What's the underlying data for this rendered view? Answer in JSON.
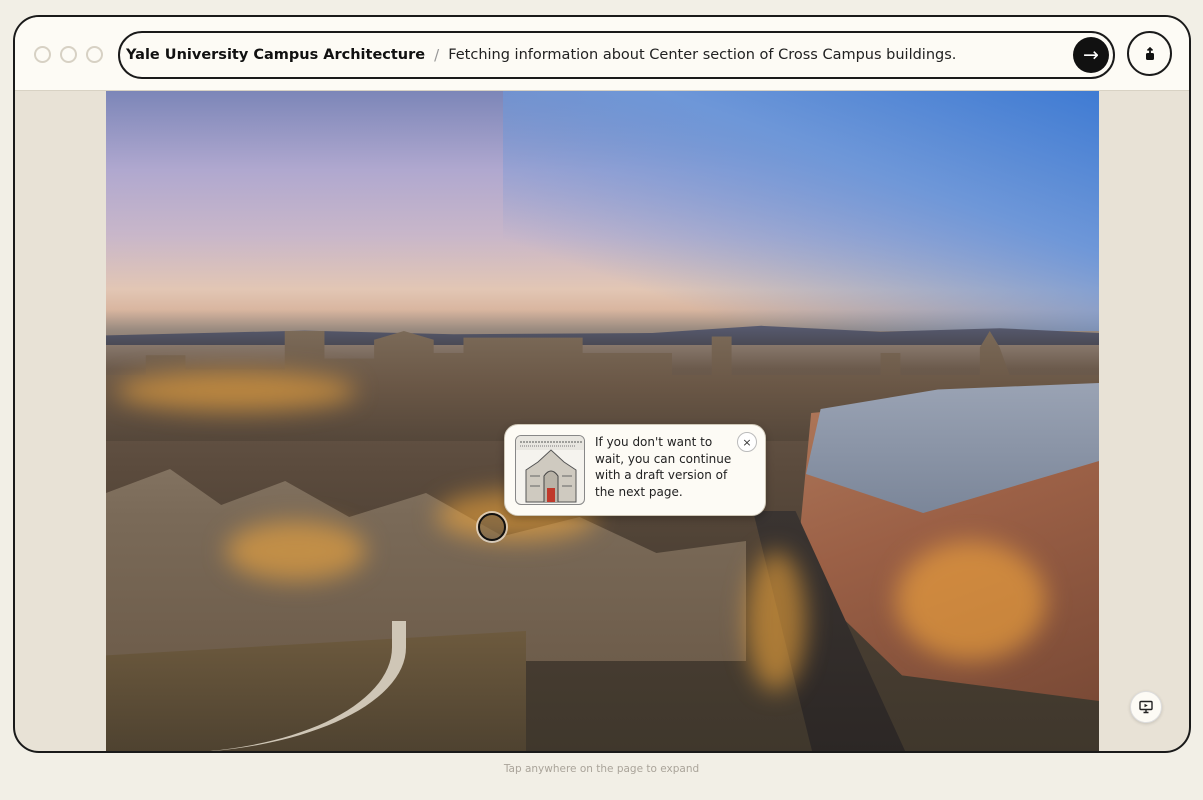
{
  "window": {
    "address_bar": {
      "site_title": "Yale University Campus Architecture",
      "separator": "/",
      "status": "Fetching information about Center section of Cross Campus buildings.",
      "go_icon": "arrow-right-icon",
      "go_label": "→"
    },
    "share_icon": "share-icon",
    "photo": {
      "icon": "photo-yale-campus-aerial-dusk"
    },
    "popup": {
      "thumbnail_icon": "gothic-building-sketch-thumbnail",
      "message": "If you don't want to wait, you can continue with a draft version of the next page.",
      "close_label": "×"
    },
    "presenter_icon": "presentation-icon"
  },
  "footer": {
    "hint": "Tap anywhere on the page to expand"
  },
  "colors": {
    "background": "#f2efe6",
    "frame": "#1a1a1a",
    "panel": "#fdfbf5"
  }
}
